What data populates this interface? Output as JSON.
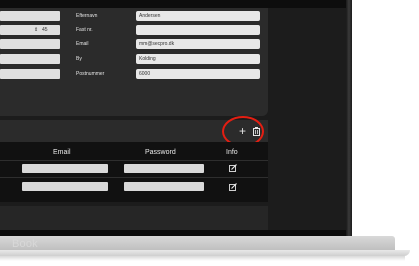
{
  "brand": "Book",
  "form": {
    "fields": [
      {
        "label": "Efternavn",
        "value": "Andersen"
      },
      {
        "label": "Fast nr.",
        "value": ""
      },
      {
        "label": "Email",
        "value": "mm@secpro.dk"
      },
      {
        "label": "By",
        "value": "Kolding"
      },
      {
        "label": "Postnummer",
        "value": "6000"
      }
    ],
    "stepper_value": "45",
    "stepper_arrows": "⇕"
  },
  "toolbar": {
    "add_icon": "plus-icon",
    "add_glyph": "+",
    "delete_icon": "trash-icon"
  },
  "annotation": {
    "color": "#e31e12"
  },
  "table": {
    "headers": [
      "Email",
      "Password",
      "Info"
    ],
    "rows": [
      {
        "email": "",
        "password": "",
        "info_icon": "edit-icon"
      },
      {
        "email": "",
        "password": "",
        "info_icon": "edit-icon"
      }
    ]
  }
}
